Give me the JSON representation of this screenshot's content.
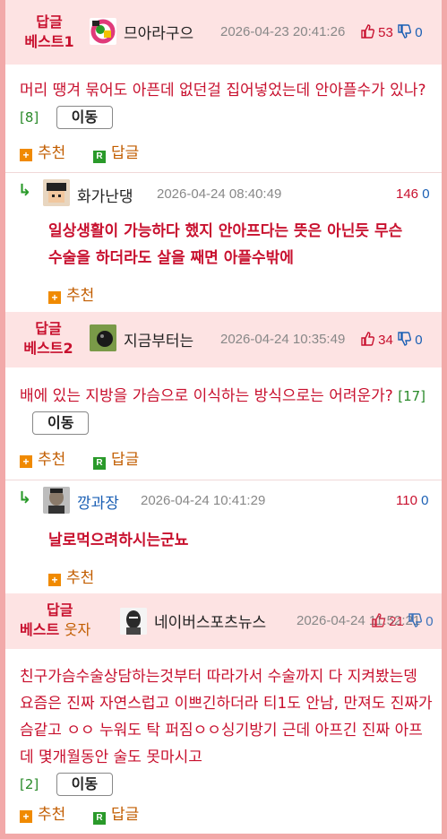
{
  "comments": [
    {
      "badge_top": "답글",
      "badge_bottom": "베스트1",
      "nickname": "므아라구으",
      "date": "2026-04-23 20:41:26",
      "up": "53",
      "down": "0",
      "body": "머리 땡겨 묶어도 아픈데 없던걸 집어넣었는데 안아플수가 있나?",
      "count": "[8]",
      "move": "이동",
      "recommend": "추천",
      "reply": "답글"
    },
    {
      "nickname": "화가난댕",
      "date": "2026-04-24 08:40:49",
      "up": "146",
      "down": "0",
      "body": "일상생활이 가능하다 했지 안아프다는 뜻은 아닌듯 무슨 수술을 하더라도 살을 째면 아플수밖에",
      "recommend": "추천"
    },
    {
      "badge_top": "답글",
      "badge_bottom": "베스트2",
      "nickname": "지금부터는",
      "date": "2026-04-24 10:35:49",
      "up": "34",
      "down": "0",
      "body": "배에 있는 지방을 가슴으로 이식하는 방식으로는 어려운가?",
      "count": "[17]",
      "move": "이동",
      "recommend": "추천",
      "reply": "답글"
    },
    {
      "nickname": "깡과장",
      "date": "2026-04-24 10:41:29",
      "up": "110",
      "down": "0",
      "body": "날로먹으려하시는군뇨",
      "recommend": "추천"
    },
    {
      "badge_top": "답글",
      "badge_bottom": "베스트",
      "badge_extra": "웃자",
      "nickname": "네이버스포츠뉴스",
      "date": "2026-04-24 11:52:21",
      "up": "21",
      "down": "0",
      "body": "친구가슴수술상담하는것부터 따라가서 수술까지 다 지켜봤는뎅 요즘은 진짜 자연스럽고 이쁘긴하더라 티1도 안남, 만져도 진짜가슴같고 ㅇㅇ 누워도 탁 퍼짐ㅇㅇ싱기방기 근데 아프긴 진짜 아프데 몇개월동안 술도 못마시고",
      "count": "[2]",
      "move": "이동",
      "recommend": "추천",
      "reply": "답글"
    }
  ],
  "icons": {
    "thumb_up": "thumbs-up-icon",
    "thumb_down": "thumbs-down-icon",
    "reply_arrow": "reply-arrow-icon",
    "plus": "plus-icon",
    "reply_badge": "reply-r-icon"
  },
  "colors": {
    "accent_red": "#c8102e",
    "down_blue": "#1a5fb4",
    "header_bg": "#fde3e3",
    "frame_border": "#f2a9a9",
    "action_orange": "#c25d00"
  }
}
